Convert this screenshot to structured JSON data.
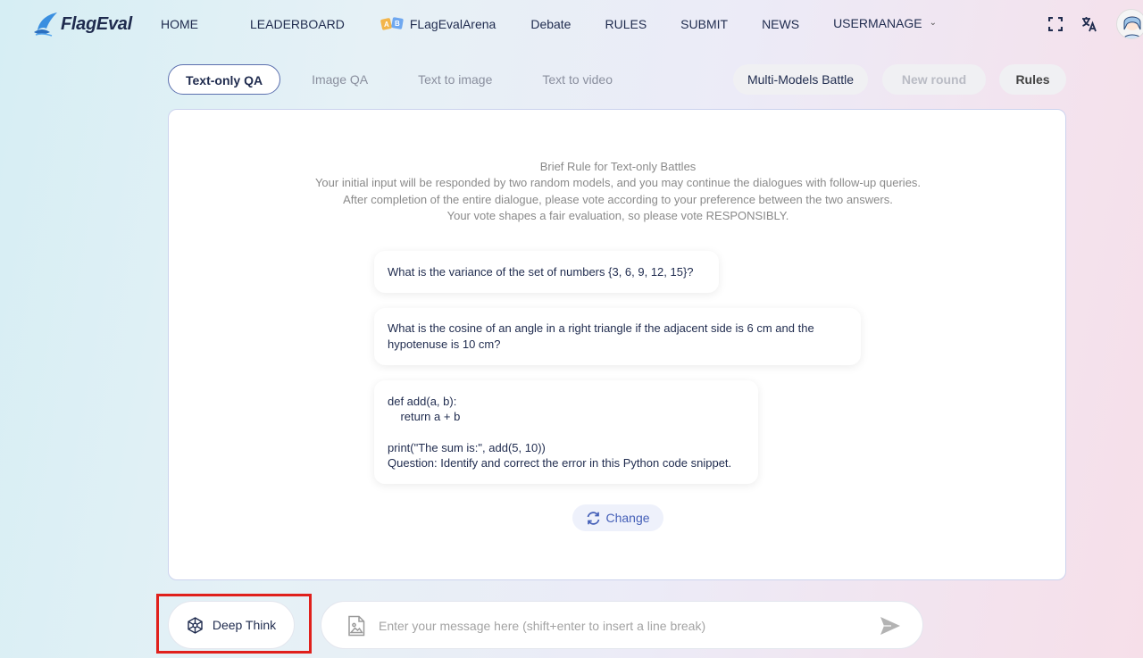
{
  "brand": {
    "name": "FlagEval",
    "accent": "#2e7fd4"
  },
  "nav": {
    "home": "HOME",
    "leaderboard": "LEADERBOARD",
    "arena": "FLagEvalArena",
    "debate": "Debate",
    "rules": "RULES",
    "submit": "SUBMIT",
    "news": "NEWS",
    "usermanage": "USERMANAGE"
  },
  "header_icons": {
    "fullscreen": "fullscreen-icon",
    "translate": "translate-icon",
    "avatar": "avatar"
  },
  "tabs": {
    "text_qa": "Text-only QA",
    "image_qa": "Image QA",
    "text_to_image": "Text to image",
    "text_to_video": "Text to video"
  },
  "actions": {
    "multi_models_battle": "Multi-Models Battle",
    "new_round": "New round",
    "rules": "Rules"
  },
  "rules_text": {
    "title": "Brief Rule for Text-only Battles",
    "line1": "Your initial input will be responded by two random models, and you may continue the dialogues with follow-up queries.",
    "line2": "After completion of the entire dialogue, please vote according to your preference between the two answers.",
    "line3": "Your vote shapes a fair evaluation, so please vote RESPONSIBLY."
  },
  "samples": {
    "q1": "What is the variance of the set of numbers {3, 6, 9, 12, 15}?",
    "q2_line1": "What is the cosine of an angle in a right triangle if the adjacent side is 6 cm and the",
    "q2_line2": "hypotenuse is 10 cm?",
    "q3_code": "def add(a, b):\n    return a + b\n\nprint(\"The sum is:\", add(5, 10))",
    "q3_question": "Question: Identify and correct the error in this Python code snippet."
  },
  "change_label": "Change",
  "deep_think_label": "Deep Think",
  "input": {
    "placeholder": "Enter your message here (shift+enter to insert a line break)",
    "value": ""
  }
}
